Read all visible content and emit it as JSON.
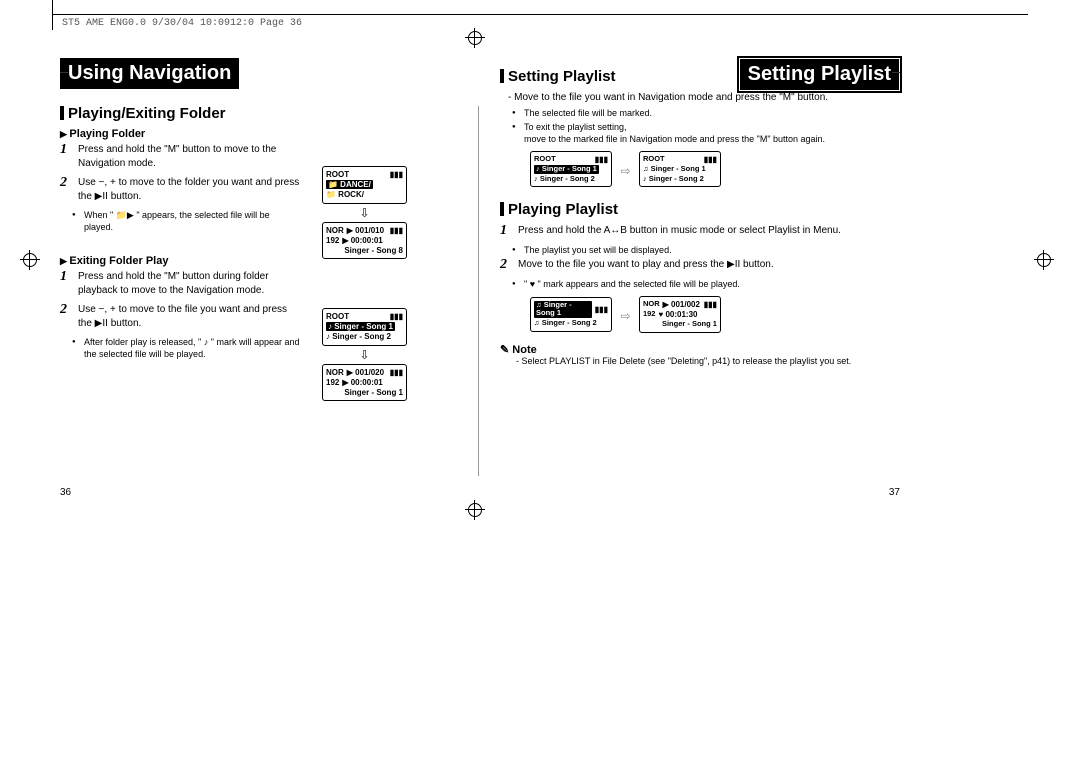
{
  "header_meta": "ST5 AME ENG0.0  9/30/04 10:0912:0  Page 36",
  "left": {
    "title": "Using Navigation",
    "section1": {
      "heading": "Playing/Exiting Folder",
      "sub1": {
        "heading": "Playing Folder",
        "step1": "Press and hold the \"M\" button to move to the Navigation mode.",
        "step2": "Use −, + to move to the folder you want and press the ▶II button.",
        "bullet": "When \" 📁▶ \" appears, the selected file will be played."
      },
      "sub2": {
        "heading": "Exiting Folder Play",
        "step1": "Press and hold the \"M\" button during folder playback to move to the Navigation mode.",
        "step2": "Use −, + to move to the file you want and press the ▶II button.",
        "bullet": "After folder play is released, \"  ♪  \" mark will appear and the selected file will be played."
      },
      "lcd1": {
        "title": "ROOT",
        "items": [
          "📁 DANCE/",
          "📁 ROCK/"
        ]
      },
      "lcd1b": {
        "a": "NOR",
        "b": "192",
        "track": "▶ 001/010",
        "time": "▶ 00:00:01",
        "song": "Singer - Song 8"
      },
      "lcd2": {
        "title": "ROOT",
        "items": [
          "♪ Singer - Song 1",
          "♪ Singer - Song 2"
        ]
      },
      "lcd2b": {
        "a": "NOR",
        "b": "192",
        "track": "▶ 001/020",
        "time": "▶ 00:00:01",
        "song": "Singer - Song 1"
      }
    },
    "page": "36"
  },
  "right": {
    "title": "Setting Playlist",
    "section1": {
      "heading": "Setting Playlist",
      "dash": "Move to the file you want in Navigation mode and press the \"M\" button.",
      "bullet1": "The selected file will be marked.",
      "bullet2": "To exit the playlist setting,",
      "bullet2b": "move to the marked file in Navigation mode and press the \"M\" button again.",
      "lcdA": {
        "title": "ROOT",
        "items": [
          "♪ Singer - Song 1",
          "♪ Singer - Song 2"
        ]
      },
      "lcdB": {
        "title": "ROOT",
        "items": [
          "♫ Singer - Song 1",
          "♪ Singer - Song 2"
        ]
      }
    },
    "section2": {
      "heading": "Playing Playlist",
      "step1_a": "Press and hold the A↔B button in music mode or select Playlist in Menu.",
      "bullet1": "The playlist you set will be displayed.",
      "step2": "Move to the file you want to play and press the ▶II button.",
      "bullet2": "\" ♥ \" mark appears and the selected file will be played.",
      "lcdA": {
        "items": [
          "♫ Singer - Song 1",
          "♫ Singer - Song 2"
        ]
      },
      "lcdB": {
        "a": "NOR",
        "b": "192",
        "track": "▶ 001/002",
        "time": "♥ 00:01:30",
        "song": "Singer - Song 1"
      }
    },
    "note_label": "Note",
    "note_text": "- Select PLAYLIST in File Delete (see \"Deleting\", p41) to release the playlist you set.",
    "page": "37"
  }
}
